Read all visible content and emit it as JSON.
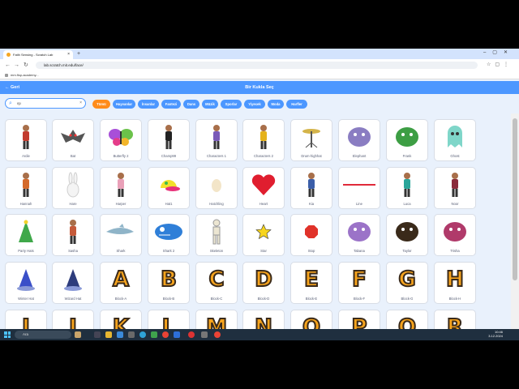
{
  "browser": {
    "tab_title": "Fatih Sensing - Scratch Lab",
    "url": "lab.scratch.mit.edu/face/",
    "bookmark": "mm.fisp-academy..."
  },
  "header": {
    "back_label": "Geri",
    "title": "Bir Kukla Seç"
  },
  "search": {
    "value": "ışı"
  },
  "filters": [
    {
      "label": "Tümü",
      "active": true
    },
    {
      "label": "Hayvanlar"
    },
    {
      "label": "İnsanlar"
    },
    {
      "label": "Fantezi"
    },
    {
      "label": "Dans"
    },
    {
      "label": "Müzik"
    },
    {
      "label": "Sporlar"
    },
    {
      "label": "Yiyecek"
    },
    {
      "label": "Moda"
    },
    {
      "label": "Harfler"
    }
  ],
  "sprites": [
    {
      "label": "Ardie",
      "kind": "person",
      "color": "#c23b2e"
    },
    {
      "label": "Bat",
      "kind": "bat",
      "color": "#555"
    },
    {
      "label": "Butterfly 2",
      "kind": "butterfly",
      "color": "#a84fd8"
    },
    {
      "label": "Champ99",
      "kind": "person",
      "color": "#222"
    },
    {
      "label": "Characters 1",
      "kind": "person",
      "color": "#7a5ab8"
    },
    {
      "label": "Characters 2",
      "kind": "person",
      "color": "#e5b21a"
    },
    {
      "label": "Drum-highhat",
      "kind": "cymbal",
      "color": "#d4b44a"
    },
    {
      "label": "Elephant",
      "kind": "blob",
      "color": "#8a7dc2"
    },
    {
      "label": "Frank",
      "kind": "blob",
      "color": "#3d9e44"
    },
    {
      "label": "Ghost",
      "kind": "ghost",
      "color": "#7fd6c9"
    },
    {
      "label": "Hannah",
      "kind": "person",
      "color": "#d4692a"
    },
    {
      "label": "Hare",
      "kind": "hare",
      "color": "#cfcfcf"
    },
    {
      "label": "Harper",
      "kind": "person",
      "color": "#e9a0b8"
    },
    {
      "label": "Hat1",
      "kind": "hat",
      "color": "#f2e12a"
    },
    {
      "label": "Hatchling",
      "kind": "egg",
      "color": "#f3e5c8"
    },
    {
      "label": "Heart",
      "kind": "heart",
      "color": "#e01e2f"
    },
    {
      "label": "Kia",
      "kind": "person",
      "color": "#3b5ea8"
    },
    {
      "label": "Line",
      "kind": "line",
      "color": "#e02a3a"
    },
    {
      "label": "Luca",
      "kind": "person",
      "color": "#2aa59a"
    },
    {
      "label": "Noor",
      "kind": "person",
      "color": "#8a2a3a"
    },
    {
      "label": "Party Hats",
      "kind": "party",
      "color": "#3fa84a"
    },
    {
      "label": "Sasha",
      "kind": "person",
      "color": "#c55a3a"
    },
    {
      "label": "Shark",
      "kind": "shark",
      "color": "#8fb4c8"
    },
    {
      "label": "Shark 2",
      "kind": "shark2",
      "color": "#2f7fd8"
    },
    {
      "label": "Skeleton",
      "kind": "skeleton",
      "color": "#ece6d2"
    },
    {
      "label": "Star",
      "kind": "star",
      "color": "#f7d51d"
    },
    {
      "label": "Stop",
      "kind": "stop",
      "color": "#e0322a"
    },
    {
      "label": "Tabana",
      "kind": "blob",
      "color": "#9b73c8"
    },
    {
      "label": "Taylor",
      "kind": "blob",
      "color": "#3a2a1a"
    },
    {
      "label": "Trisha",
      "kind": "blob",
      "color": "#b03a6a"
    },
    {
      "label": "Winter Hat",
      "kind": "wizard",
      "color": "#3a4fc8"
    },
    {
      "label": "Wizard Hat",
      "kind": "wizard",
      "color": "#2d3c7c"
    },
    {
      "label": "Block-A",
      "kind": "letter",
      "letter": "A"
    },
    {
      "label": "Block-B",
      "kind": "letter",
      "letter": "B"
    },
    {
      "label": "Block-C",
      "kind": "letter",
      "letter": "C"
    },
    {
      "label": "Block-D",
      "kind": "letter",
      "letter": "D"
    },
    {
      "label": "Block-E",
      "kind": "letter",
      "letter": "E"
    },
    {
      "label": "Block-F",
      "kind": "letter",
      "letter": "F"
    },
    {
      "label": "Block-G",
      "kind": "letter",
      "letter": "G"
    },
    {
      "label": "Block-H",
      "kind": "letter",
      "letter": "H"
    },
    {
      "label": "",
      "kind": "letter",
      "letter": "I"
    },
    {
      "label": "",
      "kind": "letter",
      "letter": "J"
    },
    {
      "label": "",
      "kind": "letter",
      "letter": "K"
    },
    {
      "label": "",
      "kind": "letter",
      "letter": "L"
    },
    {
      "label": "",
      "kind": "letter",
      "letter": "M"
    },
    {
      "label": "",
      "kind": "letter",
      "letter": "N"
    },
    {
      "label": "",
      "kind": "letter",
      "letter": "O"
    },
    {
      "label": "",
      "kind": "letter",
      "letter": "P"
    },
    {
      "label": "",
      "kind": "letter",
      "letter": "Q"
    },
    {
      "label": "",
      "kind": "letter",
      "letter": "R"
    }
  ],
  "taskbar": {
    "search_placeholder": "Ara",
    "time": "10:46",
    "date": "3.12.2024"
  },
  "colors": {
    "accent": "#4c97ff",
    "active_filter": "#ff8c1a"
  }
}
